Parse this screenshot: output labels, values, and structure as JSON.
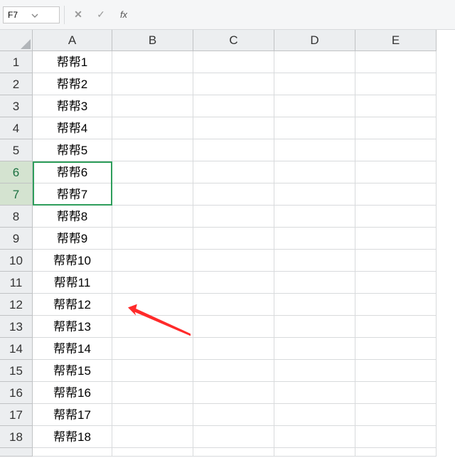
{
  "name_box": {
    "value": "F7"
  },
  "formula_bar": {
    "cancel_tip": "✕",
    "enter_tip": "✓",
    "fx_label": "fx",
    "value": ""
  },
  "columns": [
    "A",
    "B",
    "C",
    "D",
    "E"
  ],
  "rows": [
    "1",
    "2",
    "3",
    "4",
    "5",
    "6",
    "7",
    "8",
    "9",
    "10",
    "11",
    "12",
    "13",
    "14",
    "15",
    "16",
    "17",
    "18"
  ],
  "selected_rows": [
    "6",
    "7"
  ],
  "data_col_A": [
    "帮帮1",
    "帮帮2",
    "帮帮3",
    "帮帮4",
    "帮帮5",
    "帮帮6",
    "帮帮7",
    "帮帮8",
    "帮帮9",
    "帮帮10",
    "帮帮11",
    "帮帮12",
    "帮帮13",
    "帮帮14",
    "帮帮15",
    "帮帮16",
    "帮帮17",
    "帮帮18"
  ],
  "chart_data": {
    "type": "table",
    "columns": [
      "A",
      "B",
      "C",
      "D",
      "E"
    ],
    "rows": [
      [
        "帮帮1",
        "",
        "",
        "",
        ""
      ],
      [
        "帮帮2",
        "",
        "",
        "",
        ""
      ],
      [
        "帮帮3",
        "",
        "",
        "",
        ""
      ],
      [
        "帮帮4",
        "",
        "",
        "",
        ""
      ],
      [
        "帮帮5",
        "",
        "",
        "",
        ""
      ],
      [
        "帮帮6",
        "",
        "",
        "",
        ""
      ],
      [
        "帮帮7",
        "",
        "",
        "",
        ""
      ],
      [
        "帮帮8",
        "",
        "",
        "",
        ""
      ],
      [
        "帮帮9",
        "",
        "",
        "",
        ""
      ],
      [
        "帮帮10",
        "",
        "",
        "",
        ""
      ],
      [
        "帮帮11",
        "",
        "",
        "",
        ""
      ],
      [
        "帮帮12",
        "",
        "",
        "",
        ""
      ],
      [
        "帮帮13",
        "",
        "",
        "",
        ""
      ],
      [
        "帮帮14",
        "",
        "",
        "",
        ""
      ],
      [
        "帮帮15",
        "",
        "",
        "",
        ""
      ],
      [
        "帮帮16",
        "",
        "",
        "",
        ""
      ],
      [
        "帮帮17",
        "",
        "",
        "",
        ""
      ],
      [
        "帮帮18",
        "",
        "",
        "",
        ""
      ]
    ]
  }
}
